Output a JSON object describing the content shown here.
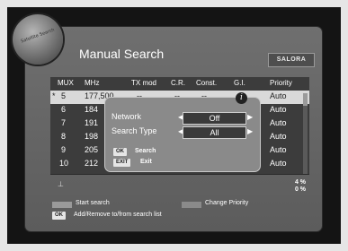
{
  "header": {
    "title": "Manual Search",
    "brand": "SALORA",
    "orb_text": "Satellite Search"
  },
  "table": {
    "columns": [
      "MUX",
      "MHz",
      "TX mod",
      "C.R.",
      "Const.",
      "G.I.",
      "Priority"
    ],
    "rows": [
      {
        "marker": "*",
        "mux": "5",
        "mhz": "177,500",
        "tx": "--",
        "cr": "--",
        "const": "--",
        "gi": "--",
        "priority": "Auto",
        "selected": true
      },
      {
        "marker": "",
        "mux": "6",
        "mhz": "184",
        "priority": "Auto",
        "selected": false
      },
      {
        "marker": "",
        "mux": "7",
        "mhz": "191",
        "priority": "Auto",
        "selected": false
      },
      {
        "marker": "",
        "mux": "8",
        "mhz": "198",
        "priority": "Auto",
        "selected": false
      },
      {
        "marker": "",
        "mux": "9",
        "mhz": "205",
        "priority": "Auto",
        "selected": false
      },
      {
        "marker": "",
        "mux": "10",
        "mhz": "212",
        "priority": "Auto",
        "selected": false
      }
    ]
  },
  "dialog": {
    "info_icon": "i",
    "network_label": "Network",
    "network_value": "Off",
    "search_type_label": "Search Type",
    "search_type_value": "All",
    "ok_key": "OK",
    "ok_label": "Search",
    "exit_key": "EXIT",
    "exit_label": "Exit"
  },
  "status": {
    "pct_top": "4 %",
    "pct_bottom": "0 %"
  },
  "legend": {
    "start_search": "Start search",
    "change_priority": "Change Priority",
    "ok_key": "OK",
    "add_remove": "Add/Remove to/from search list"
  },
  "colors": {
    "panel": "#6f6f6f",
    "table": "#3c3c3c",
    "selected_row": "#d9d9d9",
    "dialog": "#8a8a8a"
  }
}
